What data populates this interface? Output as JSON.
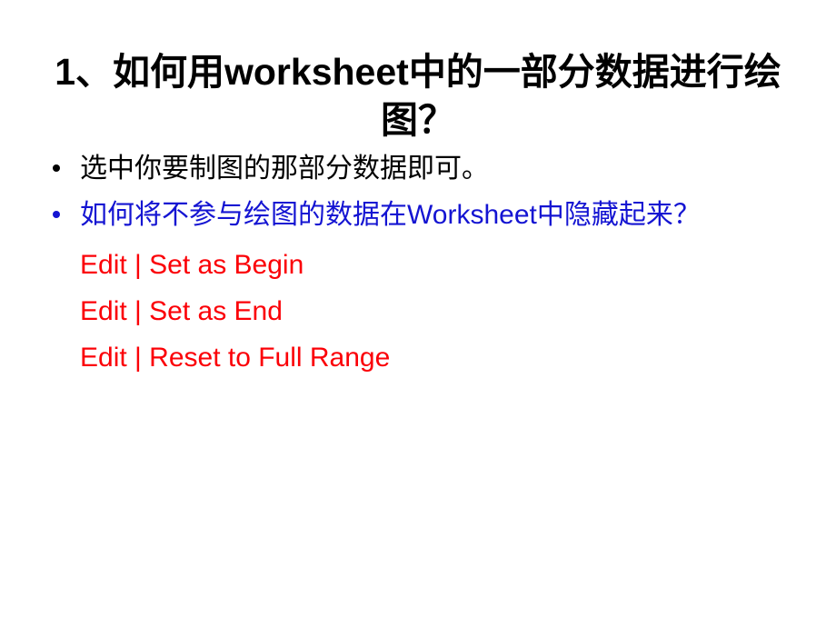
{
  "slide": {
    "background_color": "#ffffff",
    "title": {
      "full_text": "1、如何用worksheet中的一部分数据进行绘图？",
      "segment_1": "1、如何用",
      "segment_latin": "worksheet",
      "segment_2": "中的一部分数据进行绘图？",
      "color": "#000000",
      "align": "center"
    },
    "bullets": [
      {
        "id": "bullet-1",
        "text": "选中你要制图的那部分数据即可。",
        "color": "#000000",
        "bullet_glyph": "•"
      },
      {
        "id": "bullet-2",
        "text_part_1": "如何将不参与绘图的数据在",
        "text_latin": "Worksheet",
        "text_part_2": "中隐藏起来？",
        "full_text": "如何将不参与绘图的数据在Worksheet中隐藏起来？",
        "color": "#1414d2",
        "bullet_glyph": "•"
      }
    ],
    "menu_paths": {
      "color": "#fb0007",
      "items": [
        {
          "label": "Edit | Set as Begin"
        },
        {
          "label": "Edit | Set as End"
        },
        {
          "label": "Edit | Reset to Full Range"
        }
      ]
    }
  }
}
